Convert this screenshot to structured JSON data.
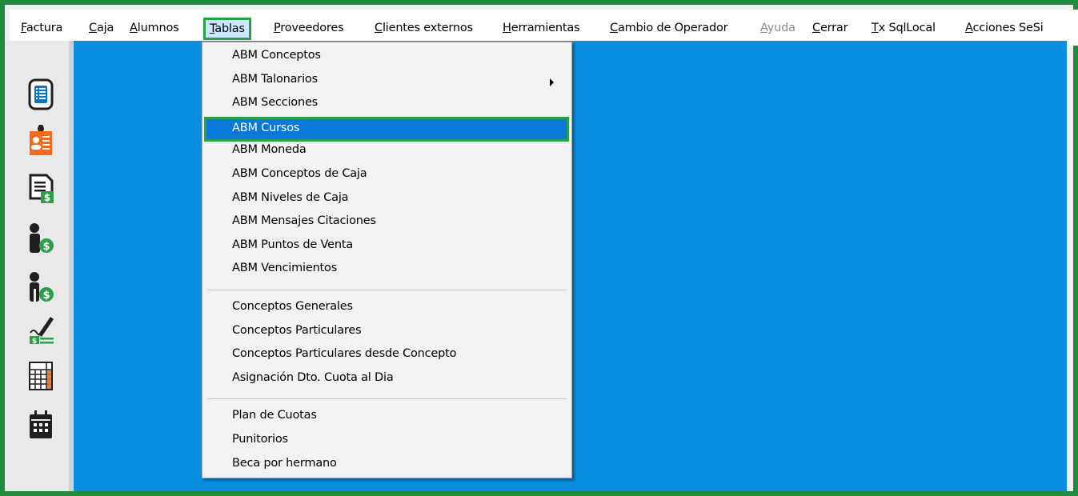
{
  "menubar": {
    "items": [
      {
        "label": "Factura",
        "accesskey": "F"
      },
      {
        "label": "Caja",
        "accesskey": "C"
      },
      {
        "label": "Alumnos",
        "accesskey": "A"
      },
      {
        "label": "Tablas",
        "accesskey": "T",
        "selected": true
      },
      {
        "label": "Proveedores",
        "accesskey": "P"
      },
      {
        "label": "Clientes externos",
        "accesskey": "C"
      },
      {
        "label": "Herramientas",
        "accesskey": "H"
      },
      {
        "label": "Cambio de Operador",
        "accesskey": "C"
      },
      {
        "label": "Ayuda",
        "accesskey": "A",
        "disabled": true
      },
      {
        "label": "Cerrar",
        "accesskey": "C"
      },
      {
        "label": "Tx SqlLocal",
        "accesskey": "T"
      },
      {
        "label": "Acciones SeSi",
        "accesskey": "A"
      }
    ]
  },
  "sidebar": {
    "icons": [
      {
        "name": "document-list-icon",
        "color": "#1f1f1f"
      },
      {
        "name": "student-badge-icon",
        "color": "#f26b1d"
      },
      {
        "name": "invoice-dollar-icon",
        "color": "#1f1f1f"
      },
      {
        "name": "person-dollar-icon",
        "color": "#2e9e4a"
      },
      {
        "name": "people-dollar-icon",
        "color": "#2e9e4a"
      },
      {
        "name": "signature-check-icon",
        "color": "#2e9e4a"
      },
      {
        "name": "calculator-icon",
        "color": "#1f1f1f"
      },
      {
        "name": "calendar-icon",
        "color": "#1f1f1f"
      }
    ]
  },
  "dropdown": {
    "groups": [
      [
        {
          "label": "ABM Conceptos"
        },
        {
          "label": "ABM Talonarios",
          "submenu": true
        },
        {
          "label": "ABM Secciones"
        },
        {
          "label": "ABM Cursos",
          "highlighted": true
        },
        {
          "label": "ABM Moneda"
        },
        {
          "label": "ABM Conceptos de Caja"
        },
        {
          "label": "ABM Niveles de Caja"
        },
        {
          "label": "ABM Mensajes Citaciones"
        },
        {
          "label": "ABM Puntos de Venta"
        },
        {
          "label": "ABM Vencimientos"
        }
      ],
      [
        {
          "label": "Conceptos Generales"
        },
        {
          "label": "Conceptos Particulares"
        },
        {
          "label": "Conceptos Particulares desde Concepto"
        },
        {
          "label": "Asignación Dto. Cuota al Dia"
        }
      ],
      [
        {
          "label": "Plan de Cuotas"
        },
        {
          "label": "Punitorios"
        },
        {
          "label": "Beca por hermano"
        }
      ]
    ]
  },
  "colors": {
    "frame_border": "#1e8b3d",
    "highlight_border": "#27a345",
    "workspace": "#0a8ee0",
    "menu_selection": "#0a78d7"
  }
}
